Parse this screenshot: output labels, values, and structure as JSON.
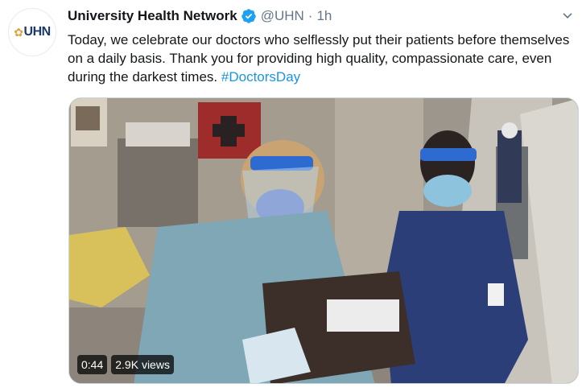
{
  "account": {
    "name": "University Health Network",
    "handle": "@UHN",
    "separator": "·",
    "time": "1h",
    "avatar_text": "UHN",
    "verified": true
  },
  "tweet": {
    "text": "Today, we celebrate our doctors who selflessly put their patients before themselves on a daily basis. Thank you for providing high quality, compassionate care, even during the darkest times.",
    "hashtag": "#DoctorsDay"
  },
  "video": {
    "duration": "0:44",
    "views": "2.9K views"
  },
  "colors": {
    "link": "#1b95e0",
    "verified": "#1da1f2",
    "secondary_text": "#657786"
  },
  "icons": [
    "verified-badge-icon",
    "chevron-down-icon",
    "uhn-logo"
  ]
}
